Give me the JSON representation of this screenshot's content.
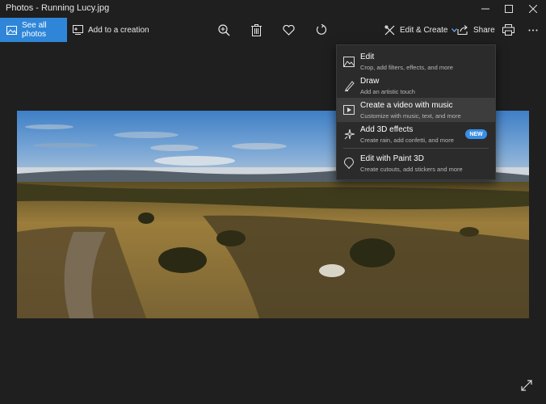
{
  "window": {
    "title": "Photos - Running Lucy.jpg"
  },
  "toolbar": {
    "see_all_label": "See all photos",
    "add_creation_label": "Add to a creation",
    "edit_create_label": "Edit & Create",
    "share_label": "Share",
    "icons": [
      "zoom-in-icon",
      "delete-icon",
      "favorite-icon",
      "rotate-icon",
      "print-icon",
      "more-icon"
    ]
  },
  "menu": {
    "items": [
      {
        "title": "Edit",
        "subtitle": "Crop, add filters, effects, and more",
        "icon": "edit-image-icon"
      },
      {
        "title": "Draw",
        "subtitle": "Add an artistic touch",
        "icon": "draw-pen-icon"
      },
      {
        "title": "Create a video with music",
        "subtitle": "Customize with music, text, and more",
        "icon": "video-icon",
        "highlighted": true
      },
      {
        "title": "Add 3D effects",
        "subtitle": "Create rain, add confetti, and more",
        "icon": "sparkle-3d-icon",
        "badge": "NEW"
      },
      {
        "title": "Edit with Paint 3D",
        "subtitle": "Create cutouts, add stickers and more",
        "icon": "paint-3d-icon"
      }
    ]
  },
  "colors": {
    "background": "#1f1f1f",
    "accent": "#2f86d8",
    "menu_background": "#2b2b2b",
    "badge": "#3a8ee6"
  }
}
